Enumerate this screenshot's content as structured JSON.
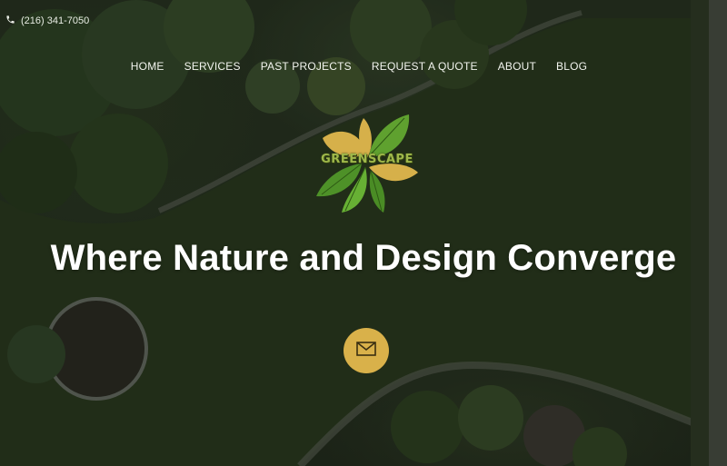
{
  "topbar": {
    "phone_icon": "phone-icon",
    "phone_text": "(216) 341-7050"
  },
  "nav": {
    "items": [
      {
        "label": "HOME"
      },
      {
        "label": "SERVICES"
      },
      {
        "label": "PAST PROJECTS"
      },
      {
        "label": "REQUEST A QUOTE"
      },
      {
        "label": "ABOUT"
      },
      {
        "label": "BLOG"
      }
    ]
  },
  "logo": {
    "text": "GREENSCAPE"
  },
  "hero": {
    "headline": "Where Nature and Design Converge",
    "cta_icon": "mail-icon"
  },
  "colors": {
    "accent": "#d9b14a",
    "leaf_green": "#5fa12f",
    "leaf_gold": "#d6b04a",
    "text": "#ffffff"
  }
}
